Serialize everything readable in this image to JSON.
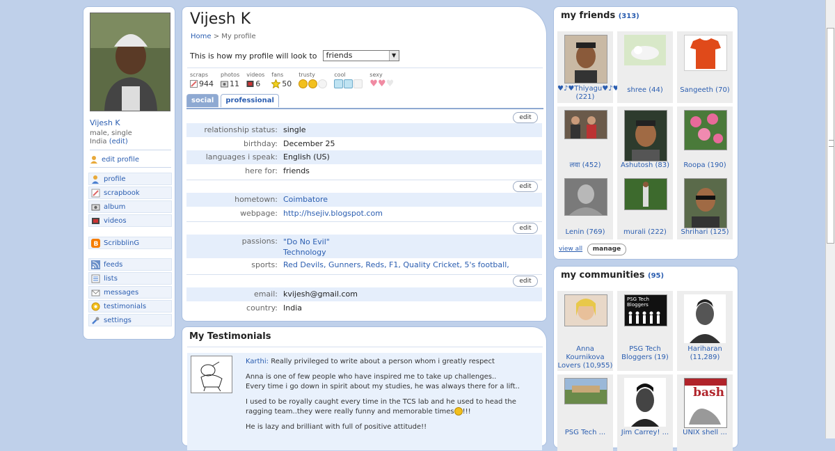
{
  "left": {
    "name": "Vijesh K",
    "info": "male, single",
    "country": "India",
    "country_edit": "(edit)",
    "edit_profile": "edit profile",
    "nav1": [
      "profile",
      "scrapbook",
      "album",
      "videos"
    ],
    "nav2": [
      "ScribblinG"
    ],
    "nav3": [
      "feeds",
      "lists",
      "messages",
      "testimonials",
      "settings"
    ]
  },
  "profile": {
    "title": "Vijesh K",
    "crumb_home": "Home",
    "crumb_sep": " > ",
    "crumb_current": "My profile",
    "view_label": "This is how my profile will look to",
    "view_value": "friends",
    "stats": [
      {
        "label": "scraps",
        "value": "944",
        "icon": "scrap-icon"
      },
      {
        "label": "photos",
        "value": "11",
        "icon": "camera-icon"
      },
      {
        "label": "videos",
        "value": "6",
        "icon": "video-icon"
      },
      {
        "label": "fans",
        "value": "50",
        "icon": "star-icon"
      }
    ],
    "ratings": [
      {
        "label": "trusty",
        "level": 2,
        "of": 3,
        "icon": "smiley-icon",
        "color": "#f2c01e"
      },
      {
        "label": "cool",
        "level": 2,
        "of": 3,
        "icon": "ice-cube-icon",
        "color": "#9dd4ea"
      },
      {
        "label": "sexy",
        "level": 2,
        "of": 3,
        "icon": "heart-icon",
        "color": "#f08aa2"
      }
    ],
    "tabs": [
      "social",
      "professional"
    ],
    "edit_label": "edit",
    "section1": [
      {
        "k": "relationship status:",
        "v": "single"
      },
      {
        "k": "birthday:",
        "v": "December 25"
      },
      {
        "k": "languages i speak:",
        "v": "English (US)"
      },
      {
        "k": "here for:",
        "v": "friends"
      }
    ],
    "section2": [
      {
        "k": "hometown:",
        "v": "Coimbatore"
      },
      {
        "k": "webpage:",
        "v": "http://hsejiv.blogspot.com"
      }
    ],
    "section3_passions_k": "passions:",
    "section3_passions_v1": "\"Do No Evil\"",
    "section3_passions_v2": "Technology",
    "section3_sports_k": "sports:",
    "section3_sports_v": "Red Devils, Gunners, Reds, F1, Quality Cricket, 5's football,",
    "section4": [
      {
        "k": "email:",
        "v": "kvijesh@gmail.com"
      },
      {
        "k": "country:",
        "v": "India"
      }
    ]
  },
  "testimonials": {
    "title": "My Testimonials",
    "author": "Karthi:",
    "line1": " Really privileged to write about a person whom i greatly respect",
    "p2a": "Anna is one of few people who have inspired me to take up challenges..",
    "p2b": "Every time i go down in spirit about my studies, he was always there for a lift..",
    "p3": "I used to be royally caught every time in the TCS lab and he used to head the ragging team..they were really funny and memorable times",
    "p3end": "!!!",
    "p4": "He is lazy and brilliant with full of positive attitude!!"
  },
  "friends": {
    "title": "my friends",
    "count": "(313)",
    "items": [
      {
        "name": "♥♪♥Thiyagu♥♪♥ (221)"
      },
      {
        "name": "shree (44)"
      },
      {
        "name": "Sangeeth (70)"
      },
      {
        "name": "लवा (452)"
      },
      {
        "name": "Ashutosh (83)"
      },
      {
        "name": "Roopa (190)"
      },
      {
        "name": "Lenin (769)"
      },
      {
        "name": "murali (222)"
      },
      {
        "name": "Shrihari (125)"
      }
    ],
    "view_all": "view all",
    "manage": "manage"
  },
  "communities": {
    "title": "my communities",
    "count": "(95)",
    "items": [
      {
        "name": "Anna Kournikova Lovers (10,955)"
      },
      {
        "name": "PSG Tech Bloggers (19)"
      },
      {
        "name": "Hariharan (11,289)"
      },
      {
        "name": "PSG Tech ..."
      },
      {
        "name": "Jim Carrey! ..."
      },
      {
        "name": "UNIX shell ..."
      }
    ],
    "psg_logo_text": "PSG Tech Bloggers",
    "bash_text": "bash"
  }
}
